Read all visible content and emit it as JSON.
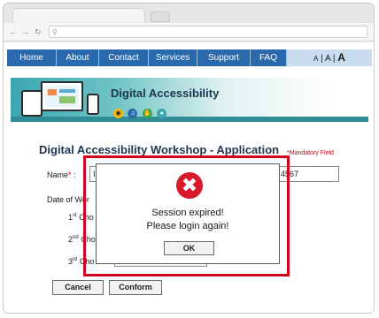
{
  "menu": {
    "items": [
      "Home",
      "About",
      "Contact",
      "Services",
      "Support",
      "FAQ"
    ],
    "font_sizes": [
      "A",
      "|",
      "A",
      "|",
      "A"
    ]
  },
  "banner": {
    "title": "Digital Accessibility",
    "icon_names": [
      "eye-icon",
      "ear-icon",
      "hand-icon",
      "brain-icon"
    ]
  },
  "form": {
    "title": "Digital Accessibility Workshop - Application",
    "mandatory_note": "*Mandatory Field",
    "name_label": "Name",
    "name_req": "*",
    "name_colon": " :",
    "name_value_left": "I",
    "name_value_right": "4567",
    "date_label": "Date of Wor",
    "choice1_num": "1",
    "choice1_sup": "st",
    "choice1_rest": " Cho",
    "choice2_num": "2",
    "choice2_sup": "nd",
    "choice2_rest": " Cho",
    "choice3_num": "3",
    "choice3_sup": "rd",
    "choice3_rest": " Cho",
    "cancel_label": "Cancel",
    "confirm_label": "Conform"
  },
  "dialog": {
    "line1": "Session expired!",
    "line2": "Please login again!",
    "ok_label": "OK"
  },
  "colors": {
    "menu_bg": "#2a6aac",
    "alert_red": "#d8192c",
    "highlight_red": "#d0021b"
  }
}
